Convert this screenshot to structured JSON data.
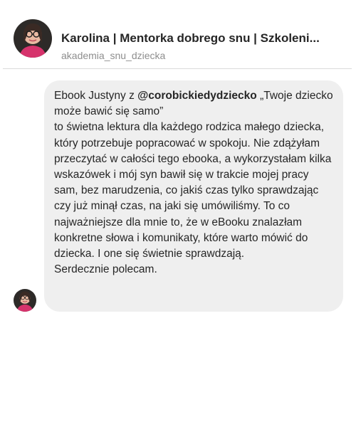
{
  "header": {
    "name": "Karolina | Mentorka dobrego snu | Szkoleni...",
    "handle": "akademia_snu_dziecka"
  },
  "message": {
    "intro": "Ebook Justyny z ",
    "mention": "@corobickiedydziecko",
    "intro_after": " „Twoje dziecko może bawić się samo”",
    "body": "to świetna lektura dla każdego rodzica małego dziecka, który potrzebuje popracować w spokoju. Nie zdążyłam przeczytać w całości tego ebooka, a wykorzystałam kilka wskazówek i mój syn bawił się w trakcie mojej pracy sam, bez marudzenia, co jakiś czas tylko sprawdzając czy już minął czas, na jaki się umówiliśmy. To co najważniejsze dla mnie to, że w eBooku znalazłam konkretne słowa i komunikaty, które warto mówić do dziecka. I one się świetnie sprawdzają.",
    "closing": "Serdecznie polecam."
  }
}
